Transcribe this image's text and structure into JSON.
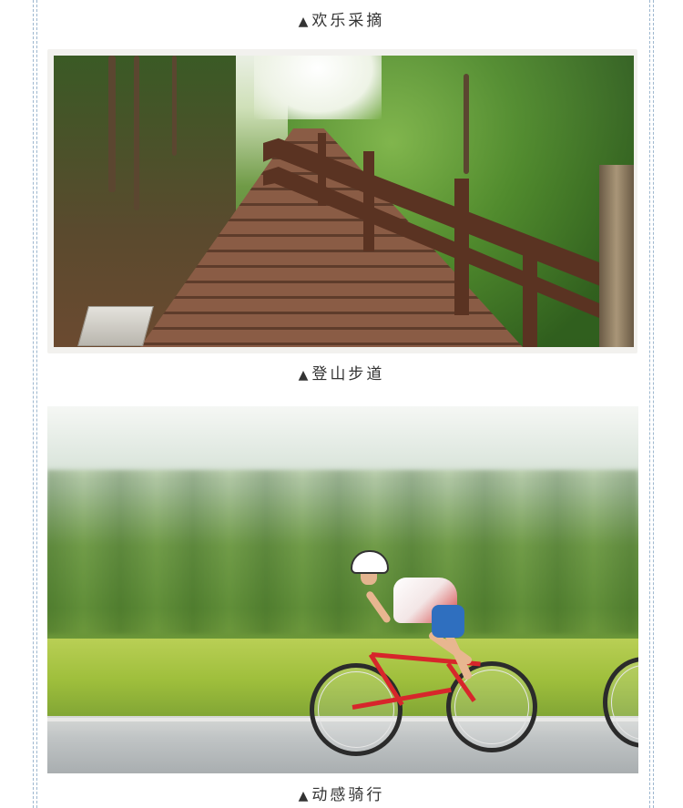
{
  "captions": {
    "fruit_picking": "欢乐采摘",
    "mountain_trail": "登山步道",
    "cycling": "动感骑行",
    "marker": "▲"
  },
  "photos": [
    {
      "subject": "wooden mountain boardwalk stairs with railing in forest"
    },
    {
      "subject": "cyclist riding road bike past blurred green hedge"
    }
  ],
  "colors": {
    "frame_dash": "#9db7cf",
    "caption_text": "#333333"
  }
}
